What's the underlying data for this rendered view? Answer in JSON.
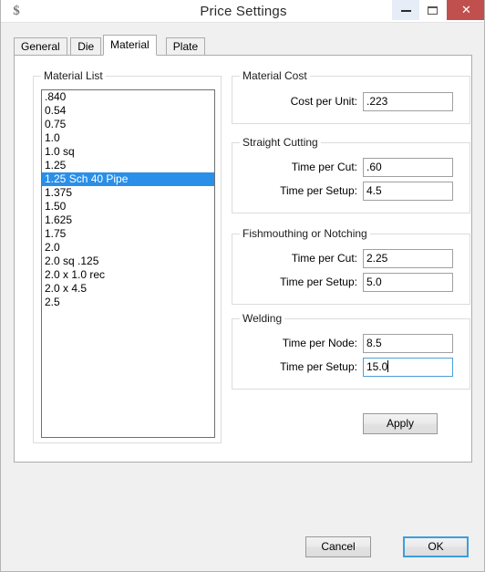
{
  "window": {
    "title": "Price Settings",
    "icon": "dollar-sign-icon",
    "minimize_label": "",
    "maximize_label": "",
    "close_label": "✕",
    "accent_selection": "#2a8fe8",
    "close_button_color": "#c0504d",
    "focus_border_color": "#3c9fdc"
  },
  "tabs": [
    {
      "label": "General",
      "selected": false
    },
    {
      "label": "Die",
      "selected": false
    },
    {
      "label": "Material",
      "selected": true
    },
    {
      "label": "Plate",
      "selected": false
    }
  ],
  "material_list": {
    "group_label": "Material List",
    "items": [
      ".840",
      "0.54",
      "0.75",
      "1.0",
      "1.0 sq",
      "1.25",
      "1.25 Sch 40 Pipe",
      "1.375",
      "1.50",
      "1.625",
      "1.75",
      "2.0",
      "2.0 sq .125",
      "2.0 x 1.0 rec",
      "2.0 x 4.5",
      "2.5"
    ],
    "selected_index": 6
  },
  "material_cost": {
    "group_label": "Material Cost",
    "fields": [
      {
        "label": "Cost per Unit:",
        "value": ".223",
        "focused": false
      }
    ]
  },
  "straight_cutting": {
    "group_label": "Straight Cutting",
    "fields": [
      {
        "label": "Time per Cut:",
        "value": ".60",
        "focused": false
      },
      {
        "label": "Time per Setup:",
        "value": "4.5",
        "focused": false
      }
    ]
  },
  "fishmouthing": {
    "group_label": "Fishmouthing or Notching",
    "fields": [
      {
        "label": "Time per Cut:",
        "value": "2.25",
        "focused": false
      },
      {
        "label": "Time per Setup:",
        "value": "5.0",
        "focused": false
      }
    ]
  },
  "welding": {
    "group_label": "Welding",
    "fields": [
      {
        "label": "Time per Node:",
        "value": "8.5",
        "focused": false
      },
      {
        "label": "Time per Setup:",
        "value": "15.0",
        "focused": true
      }
    ]
  },
  "buttons": {
    "apply": "Apply",
    "cancel": "Cancel",
    "ok": "OK"
  }
}
